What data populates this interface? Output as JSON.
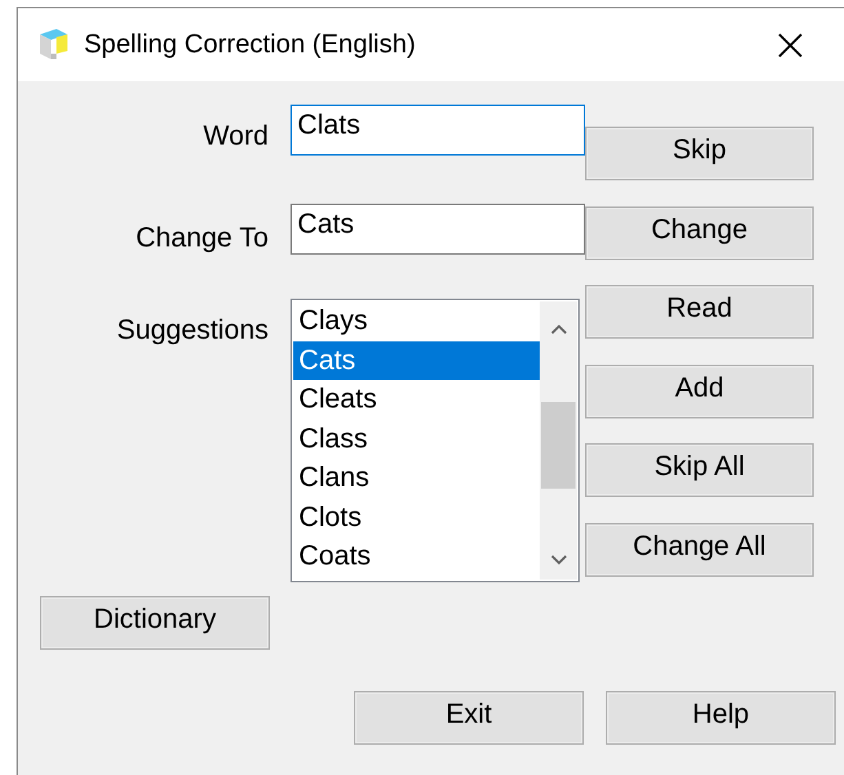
{
  "window": {
    "title": "Spelling Correction (English)"
  },
  "fields": [
    {
      "label": "Word",
      "value": "Clats",
      "focused": true
    },
    {
      "label": "Change To",
      "value": "Cats",
      "focused": false
    }
  ],
  "suggestions": {
    "label": "Suggestions",
    "items": [
      {
        "text": "Clays",
        "selected": false
      },
      {
        "text": "Cats",
        "selected": true
      },
      {
        "text": "Cleats",
        "selected": false
      },
      {
        "text": "Class",
        "selected": false
      },
      {
        "text": "Clans",
        "selected": false
      },
      {
        "text": "Clots",
        "selected": false
      },
      {
        "text": "Coats",
        "selected": false
      }
    ]
  },
  "side_buttons": [
    "Skip",
    "Change",
    "Read",
    "Add",
    "Skip All",
    "Change All"
  ],
  "dictionary_button": "Dictionary",
  "bottom_buttons": [
    "Exit",
    "Help"
  ]
}
